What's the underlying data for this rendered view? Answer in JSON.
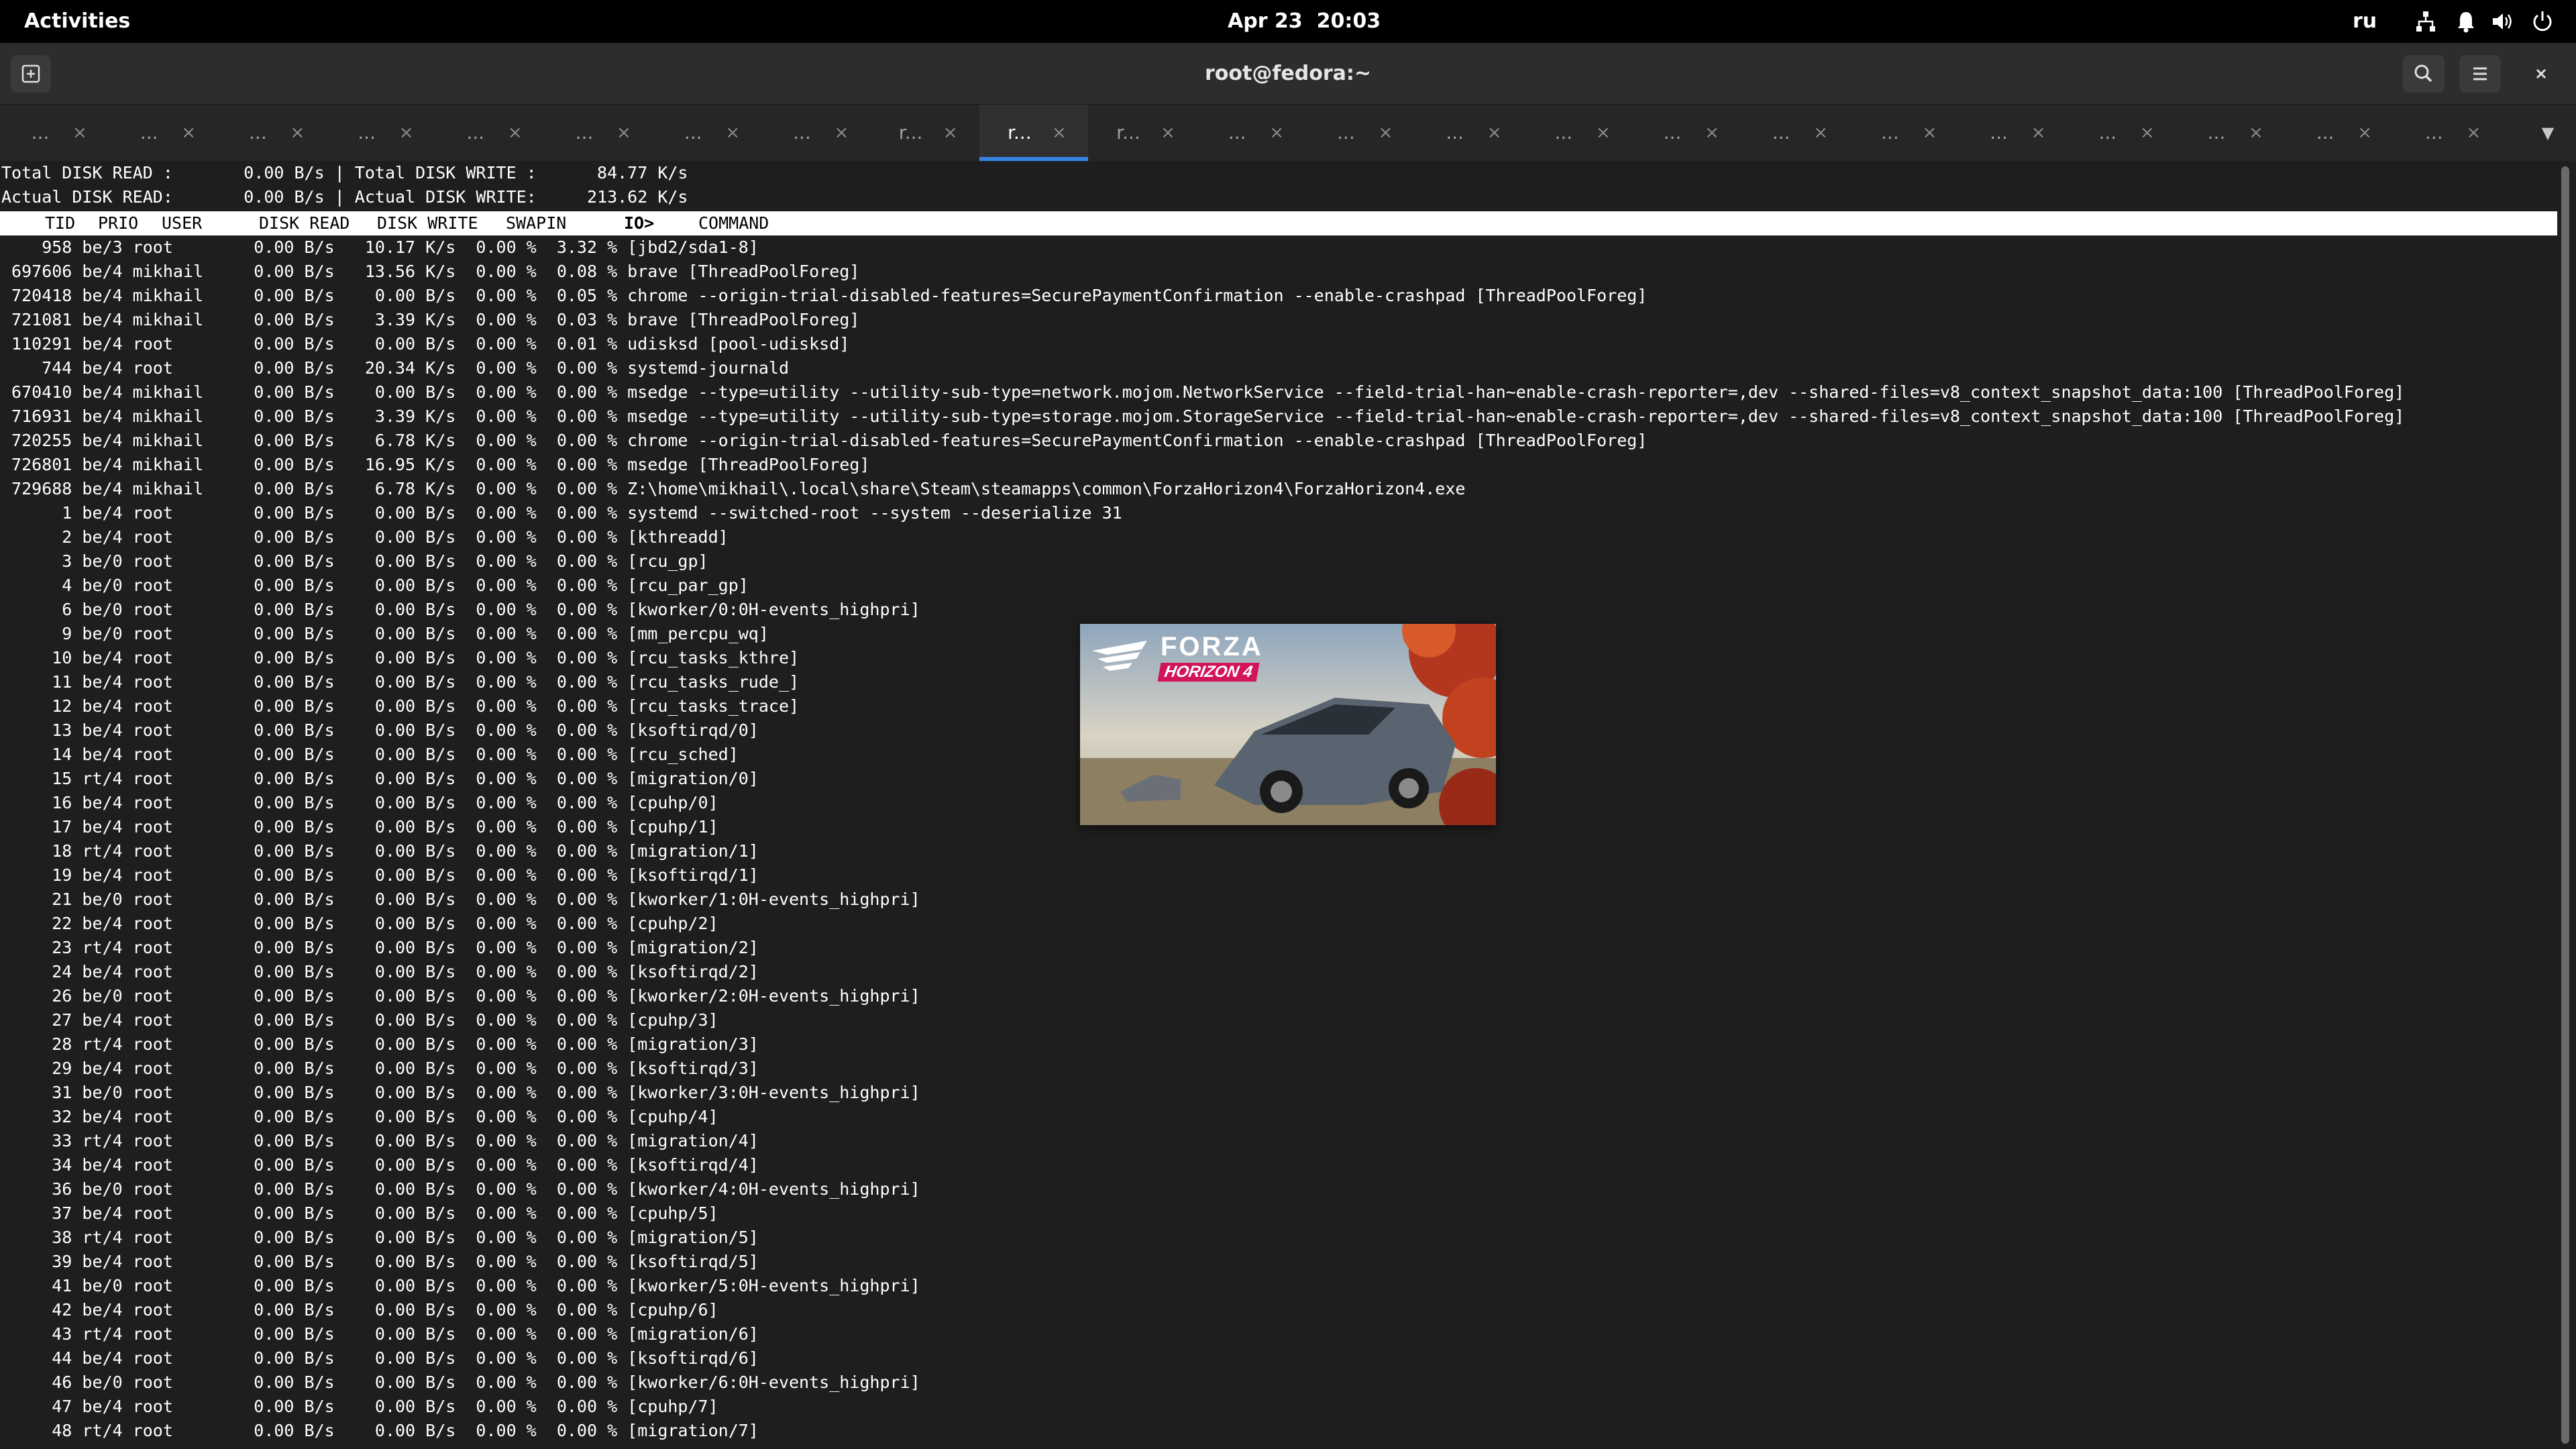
{
  "topbar": {
    "activities": "Activities",
    "clock": "Apr 23  20:03",
    "language": "ru",
    "icons": [
      "network-icon",
      "notification-icon",
      "volume-icon",
      "power-icon"
    ]
  },
  "window": {
    "title": "root@fedora:~"
  },
  "tabs": {
    "items": [
      {
        "label": "...",
        "active": false
      },
      {
        "label": "...",
        "active": false
      },
      {
        "label": "...",
        "active": false
      },
      {
        "label": "...",
        "active": false
      },
      {
        "label": "...",
        "active": false
      },
      {
        "label": "...",
        "active": false
      },
      {
        "label": "...",
        "active": false
      },
      {
        "label": "...",
        "active": false
      },
      {
        "label": "r...",
        "active": false
      },
      {
        "label": "r...",
        "active": true
      },
      {
        "label": "r...",
        "active": false
      },
      {
        "label": "...",
        "active": false
      },
      {
        "label": "...",
        "active": false
      },
      {
        "label": "...",
        "active": false
      },
      {
        "label": "...",
        "active": false
      },
      {
        "label": "...",
        "active": false
      },
      {
        "label": "...",
        "active": false
      },
      {
        "label": "...",
        "active": false
      },
      {
        "label": "...",
        "active": false
      },
      {
        "label": "...",
        "active": false
      },
      {
        "label": "...",
        "active": false
      },
      {
        "label": "...",
        "active": false
      },
      {
        "label": "...",
        "active": false
      }
    ],
    "close_glyph": "×",
    "menu_glyph": "▼"
  },
  "terminal": {
    "summary_line1": "Total DISK READ :       0.00 B/s | Total DISK WRITE :      84.77 K/s",
    "summary_line2": "Actual DISK READ:       0.00 B/s | Actual DISK WRITE:     213.62 K/s",
    "header": {
      "tid": "TID",
      "prio": "PRIO",
      "user": "USER",
      "disk_read": "DISK READ",
      "disk_write": "DISK WRITE",
      "swapin": "SWAPIN",
      "io": "IO>",
      "command": "COMMAND"
    },
    "rows": [
      "    958 be/3 root        0.00 B/s   10.17 K/s  0.00 %  3.32 % [jbd2/sda1-8]",
      " 697606 be/4 mikhail     0.00 B/s   13.56 K/s  0.00 %  0.08 % brave [ThreadPoolForeg]",
      " 720418 be/4 mikhail     0.00 B/s    0.00 B/s  0.00 %  0.05 % chrome --origin-trial-disabled-features=SecurePaymentConfirmation --enable-crashpad [ThreadPoolForeg]",
      " 721081 be/4 mikhail     0.00 B/s    3.39 K/s  0.00 %  0.03 % brave [ThreadPoolForeg]",
      " 110291 be/4 root        0.00 B/s    0.00 B/s  0.00 %  0.01 % udisksd [pool-udisksd]",
      "    744 be/4 root        0.00 B/s   20.34 K/s  0.00 %  0.00 % systemd-journald",
      " 670410 be/4 mikhail     0.00 B/s    0.00 B/s  0.00 %  0.00 % msedge --type=utility --utility-sub-type=network.mojom.NetworkService --field-trial-han~enable-crash-reporter=,dev --shared-files=v8_context_snapshot_data:100 [ThreadPoolForeg]",
      " 716931 be/4 mikhail     0.00 B/s    3.39 K/s  0.00 %  0.00 % msedge --type=utility --utility-sub-type=storage.mojom.StorageService --field-trial-han~enable-crash-reporter=,dev --shared-files=v8_context_snapshot_data:100 [ThreadPoolForeg]",
      " 720255 be/4 mikhail     0.00 B/s    6.78 K/s  0.00 %  0.00 % chrome --origin-trial-disabled-features=SecurePaymentConfirmation --enable-crashpad [ThreadPoolForeg]",
      " 726801 be/4 mikhail     0.00 B/s   16.95 K/s  0.00 %  0.00 % msedge [ThreadPoolForeg]",
      " 729688 be/4 mikhail     0.00 B/s    6.78 K/s  0.00 %  0.00 % Z:\\home\\mikhail\\.local\\share\\Steam\\steamapps\\common\\ForzaHorizon4\\ForzaHorizon4.exe",
      "      1 be/4 root        0.00 B/s    0.00 B/s  0.00 %  0.00 % systemd --switched-root --system --deserialize 31",
      "      2 be/4 root        0.00 B/s    0.00 B/s  0.00 %  0.00 % [kthreadd]",
      "      3 be/0 root        0.00 B/s    0.00 B/s  0.00 %  0.00 % [rcu_gp]",
      "      4 be/0 root        0.00 B/s    0.00 B/s  0.00 %  0.00 % [rcu_par_gp]",
      "      6 be/0 root        0.00 B/s    0.00 B/s  0.00 %  0.00 % [kworker/0:0H-events_highpri]",
      "      9 be/0 root        0.00 B/s    0.00 B/s  0.00 %  0.00 % [mm_percpu_wq]",
      "     10 be/4 root        0.00 B/s    0.00 B/s  0.00 %  0.00 % [rcu_tasks_kthre]",
      "     11 be/4 root        0.00 B/s    0.00 B/s  0.00 %  0.00 % [rcu_tasks_rude_]",
      "     12 be/4 root        0.00 B/s    0.00 B/s  0.00 %  0.00 % [rcu_tasks_trace]",
      "     13 be/4 root        0.00 B/s    0.00 B/s  0.00 %  0.00 % [ksoftirqd/0]",
      "     14 be/4 root        0.00 B/s    0.00 B/s  0.00 %  0.00 % [rcu_sched]",
      "     15 rt/4 root        0.00 B/s    0.00 B/s  0.00 %  0.00 % [migration/0]",
      "     16 be/4 root        0.00 B/s    0.00 B/s  0.00 %  0.00 % [cpuhp/0]",
      "     17 be/4 root        0.00 B/s    0.00 B/s  0.00 %  0.00 % [cpuhp/1]",
      "     18 rt/4 root        0.00 B/s    0.00 B/s  0.00 %  0.00 % [migration/1]",
      "     19 be/4 root        0.00 B/s    0.00 B/s  0.00 %  0.00 % [ksoftirqd/1]",
      "     21 be/0 root        0.00 B/s    0.00 B/s  0.00 %  0.00 % [kworker/1:0H-events_highpri]",
      "     22 be/4 root        0.00 B/s    0.00 B/s  0.00 %  0.00 % [cpuhp/2]",
      "     23 rt/4 root        0.00 B/s    0.00 B/s  0.00 %  0.00 % [migration/2]",
      "     24 be/4 root        0.00 B/s    0.00 B/s  0.00 %  0.00 % [ksoftirqd/2]",
      "     26 be/0 root        0.00 B/s    0.00 B/s  0.00 %  0.00 % [kworker/2:0H-events_highpri]",
      "     27 be/4 root        0.00 B/s    0.00 B/s  0.00 %  0.00 % [cpuhp/3]",
      "     28 rt/4 root        0.00 B/s    0.00 B/s  0.00 %  0.00 % [migration/3]",
      "     29 be/4 root        0.00 B/s    0.00 B/s  0.00 %  0.00 % [ksoftirqd/3]",
      "     31 be/0 root        0.00 B/s    0.00 B/s  0.00 %  0.00 % [kworker/3:0H-events_highpri]",
      "     32 be/4 root        0.00 B/s    0.00 B/s  0.00 %  0.00 % [cpuhp/4]",
      "     33 rt/4 root        0.00 B/s    0.00 B/s  0.00 %  0.00 % [migration/4]",
      "     34 be/4 root        0.00 B/s    0.00 B/s  0.00 %  0.00 % [ksoftirqd/4]",
      "     36 be/0 root        0.00 B/s    0.00 B/s  0.00 %  0.00 % [kworker/4:0H-events_highpri]",
      "     37 be/4 root        0.00 B/s    0.00 B/s  0.00 %  0.00 % [cpuhp/5]",
      "     38 rt/4 root        0.00 B/s    0.00 B/s  0.00 %  0.00 % [migration/5]",
      "     39 be/4 root        0.00 B/s    0.00 B/s  0.00 %  0.00 % [ksoftirqd/5]",
      "     41 be/0 root        0.00 B/s    0.00 B/s  0.00 %  0.00 % [kworker/5:0H-events_highpri]",
      "     42 be/4 root        0.00 B/s    0.00 B/s  0.00 %  0.00 % [cpuhp/6]",
      "     43 rt/4 root        0.00 B/s    0.00 B/s  0.00 %  0.00 % [migration/6]",
      "     44 be/4 root        0.00 B/s    0.00 B/s  0.00 %  0.00 % [ksoftirqd/6]",
      "     46 be/0 root        0.00 B/s    0.00 B/s  0.00 %  0.00 % [kworker/6:0H-events_highpri]",
      "     47 be/4 root        0.00 B/s    0.00 B/s  0.00 %  0.00 % [cpuhp/7]",
      "     48 rt/4 root        0.00 B/s    0.00 B/s  0.00 %  0.00 % [migration/7]"
    ]
  },
  "overlay_image": {
    "logo_text": "FORZA",
    "logo_subtext": "HORIZON 4"
  },
  "colors": {
    "accent": "#3584e4",
    "terminal_bg": "#1e1e1e",
    "header_bg": "#2d2d2d",
    "topbar_bg": "#000000"
  }
}
